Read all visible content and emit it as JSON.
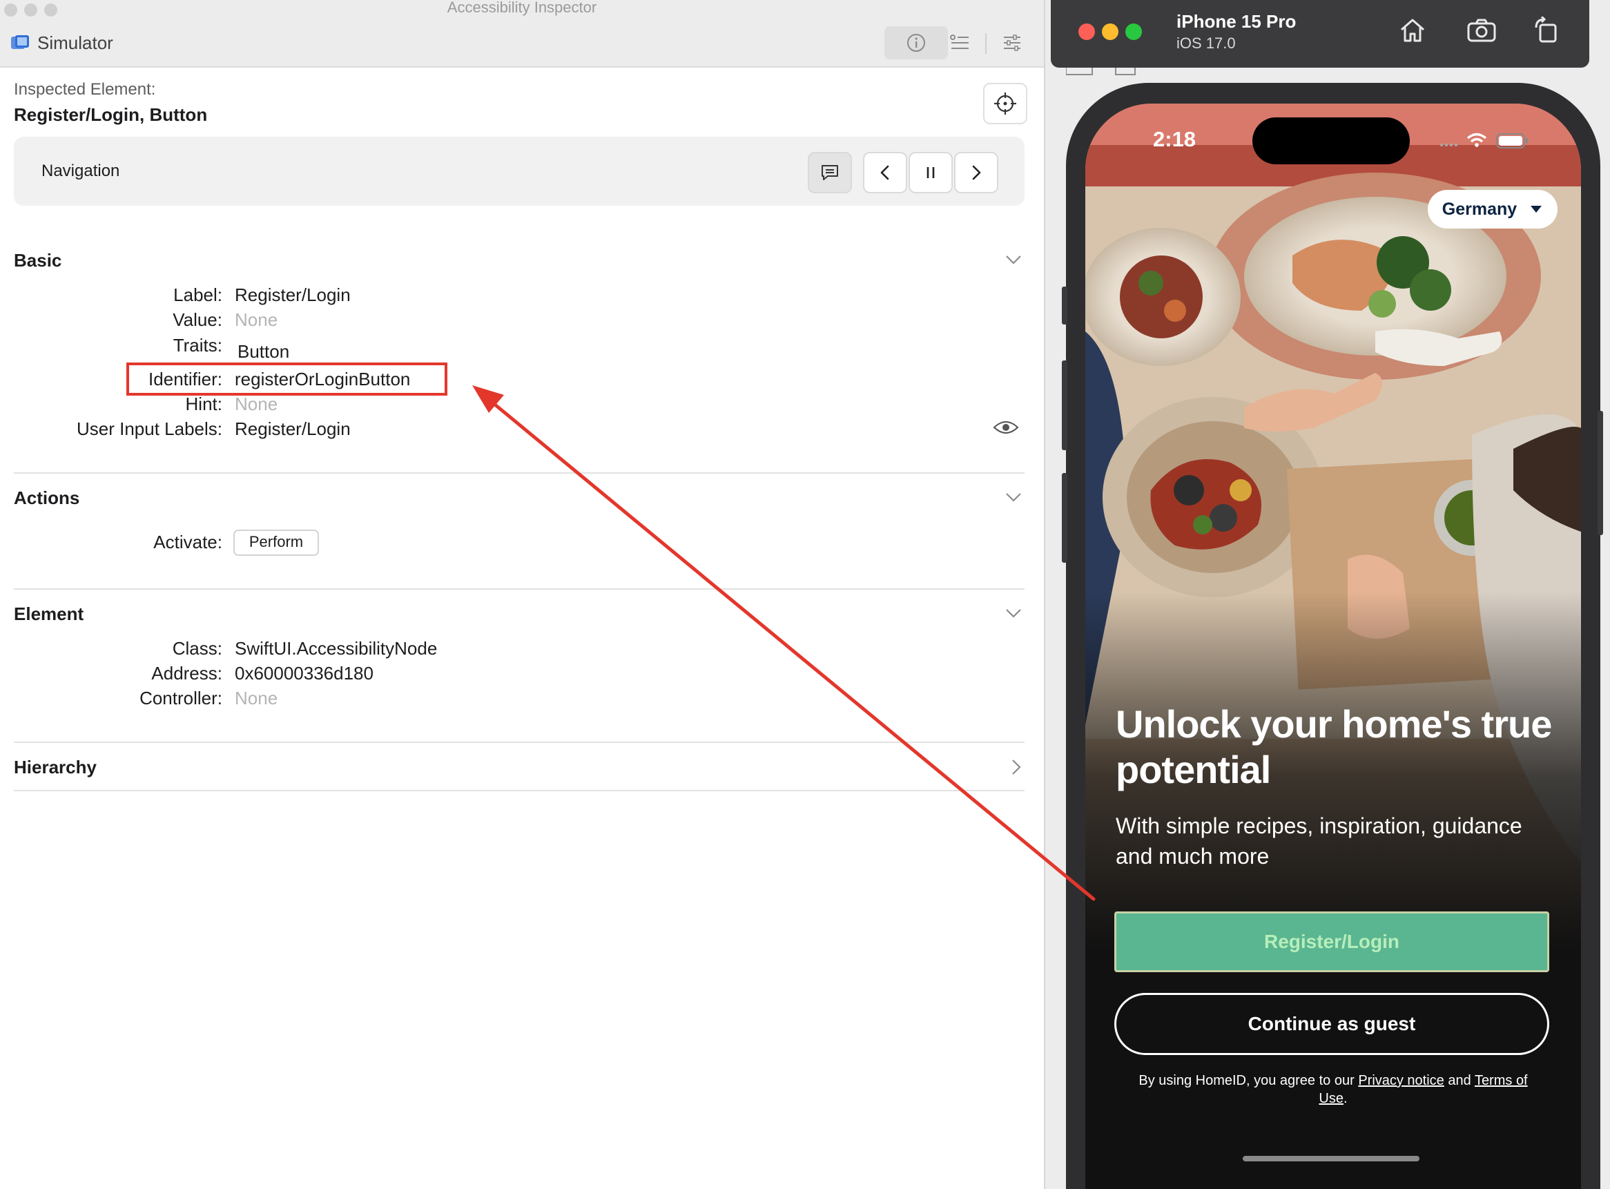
{
  "inspector": {
    "window_title": "Accessibility Inspector",
    "target": "Simulator",
    "inspected_label": "Inspected Element:",
    "inspected_value": "Register/Login, Button",
    "navigation_label": "Navigation",
    "sections": {
      "basic": {
        "title": "Basic",
        "label_key": "Label:",
        "label_val": "Register/Login",
        "value_key": "Value:",
        "value_val": "None",
        "traits_key": "Traits:",
        "traits_val": "Button",
        "identifier_key": "Identifier:",
        "identifier_val": "registerOrLoginButton",
        "hint_key": "Hint:",
        "hint_val": "None",
        "user_input_key": "User Input Labels:",
        "user_input_val": "Register/Login"
      },
      "actions": {
        "title": "Actions",
        "activate_key": "Activate:",
        "perform_label": "Perform"
      },
      "element": {
        "title": "Element",
        "class_key": "Class:",
        "class_val": "SwiftUI.AccessibilityNode",
        "address_key": "Address:",
        "address_val": "0x60000336d180",
        "controller_key": "Controller:",
        "controller_val": "None"
      },
      "hierarchy": {
        "title": "Hierarchy"
      }
    },
    "highlight_color": "#e3372c"
  },
  "simulator": {
    "device_name": "iPhone 15 Pro",
    "os_version": "iOS 17.0",
    "status_time": "2:18",
    "country": "Germany",
    "hero_title": "Unlock your home's true potential",
    "hero_subtitle": "With simple recipes, inspiration, guidance and much more",
    "register_label": "Register/Login",
    "guest_label": "Continue as guest",
    "legal_prefix": "By using HomeID, you agree to our ",
    "privacy_link": "Privacy notice",
    "legal_and": " and ",
    "terms_link": "Terms of Use",
    "legal_suffix": ".",
    "accent_green": "#5ab591"
  }
}
